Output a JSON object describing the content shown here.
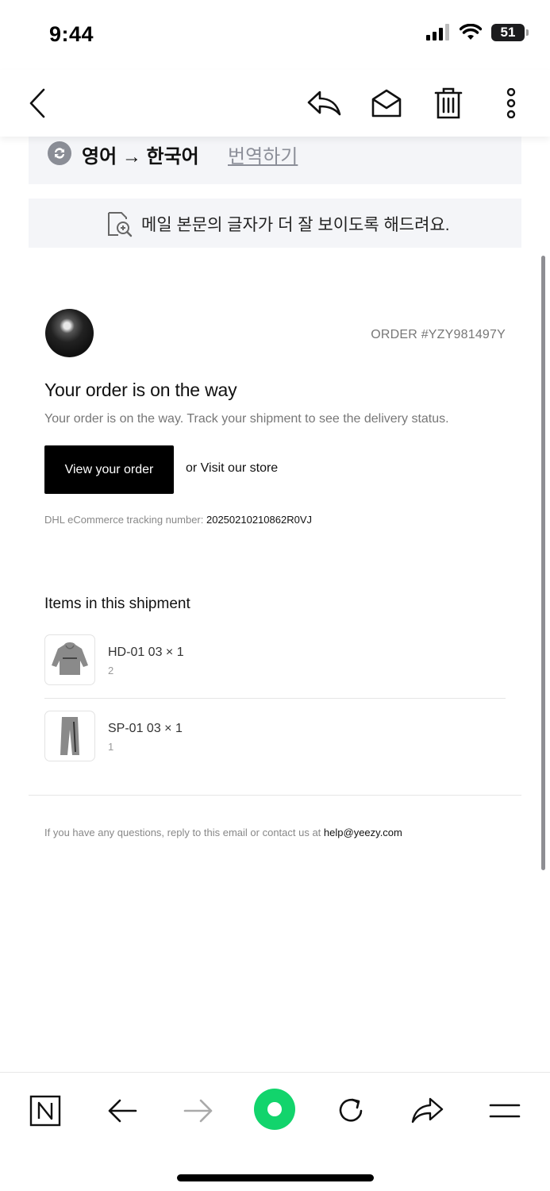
{
  "status_bar": {
    "time": "9:44",
    "battery": "51"
  },
  "mail_toolbar": {
    "icons": [
      "back-chevron-icon",
      "reply-icon",
      "mark-unread-icon",
      "trash-icon",
      "more-icon"
    ]
  },
  "translate": {
    "languages": "영어 → 한국어",
    "action": "번역하기"
  },
  "zoom_banner": {
    "text": "메일 본문의 글자가 더 잘 보이도록 해드려요."
  },
  "email": {
    "order_number": "ORDER #YZY981497Y",
    "title": "Your order is on the way",
    "description": "Your order is on the way. Track your shipment to see the delivery status.",
    "view_button": "View your order",
    "visit_link": "or Visit our store",
    "tracking_label": "DHL eCommerce tracking number: ",
    "tracking_number": "20250210210862R0VJ",
    "items_title": "Items in this shipment",
    "items": [
      {
        "name": "HD-01 03 × 1",
        "qty": "2"
      },
      {
        "name": "SP-01 03 × 1",
        "qty": "1"
      }
    ],
    "footer_text": "If you have any questions, reply to this email or contact us at ",
    "footer_email": "help@yeezy.com"
  },
  "browser_bar": {
    "icons": [
      "naver-n-icon",
      "back-arrow-icon",
      "forward-arrow-icon",
      "green-dot-icon",
      "reload-icon",
      "share-icon",
      "menu-icon"
    ]
  },
  "colors": {
    "accent_green": "#12d46c",
    "button_black": "#000000",
    "banner_gray": "#f4f5f8"
  }
}
